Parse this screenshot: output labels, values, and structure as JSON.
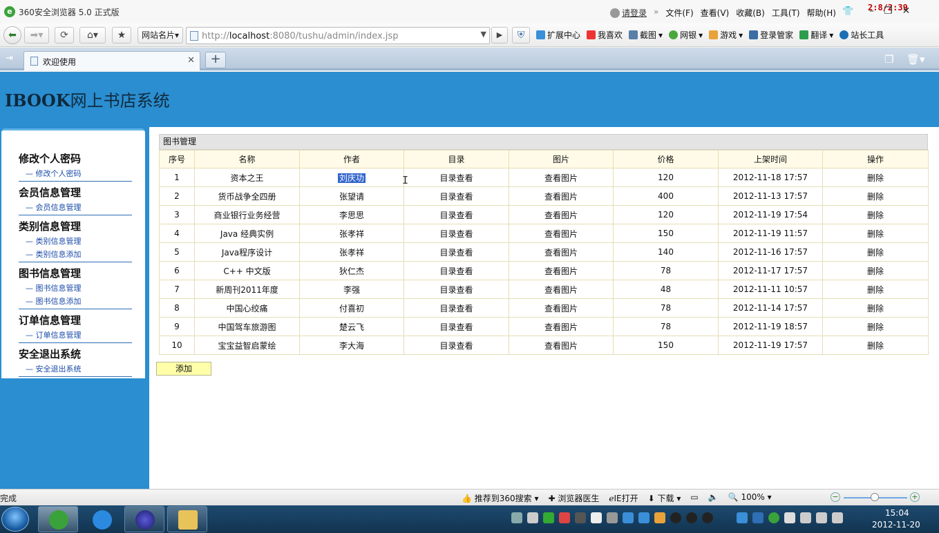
{
  "browser": {
    "title": "360安全浏览器 5.0 正式版",
    "menus": {
      "login": "请登录",
      "more": "»",
      "file": "文件(F)",
      "view": "查看(V)",
      "favorites": "收藏(B)",
      "tools": "工具(T)",
      "help": "帮助(H)"
    },
    "overlay_clock": "2:8/2:39",
    "address": {
      "card_label": "网站名片",
      "url_prefix": "http://",
      "url_host": "localhost",
      "url_rest": ":8080/tushu/admin/index.jsp"
    },
    "toolbar": [
      "扩展中心",
      "我喜欢",
      "截图",
      "网银",
      "游戏",
      "登录管家",
      "翻译",
      "站长工具"
    ],
    "tab": {
      "label": "欢迎使用"
    }
  },
  "site": {
    "brand": "IBOOK",
    "name": "网上书店系统"
  },
  "sidebar": [
    {
      "title": "修改个人密码",
      "links": [
        "修改个人密码"
      ]
    },
    {
      "title": "会员信息管理",
      "links": [
        "会员信息管理"
      ]
    },
    {
      "title": "类别信息管理",
      "links": [
        "类别信息管理",
        "类别信息添加"
      ]
    },
    {
      "title": "图书信息管理",
      "links": [
        "图书信息管理",
        "图书信息添加"
      ]
    },
    {
      "title": "订单信息管理",
      "links": [
        "订单信息管理"
      ]
    },
    {
      "title": "安全退出系统",
      "links": [
        "安全退出系统"
      ]
    }
  ],
  "books": {
    "caption": "图书管理",
    "columns": [
      "序号",
      "名称",
      "作者",
      "目录",
      "图片",
      "价格",
      "上架时间",
      "操作"
    ],
    "catalog_link": "目录查看",
    "image_link": "查看图片",
    "delete_link": "删除",
    "rows": [
      {
        "id": "1",
        "name": "资本之王",
        "author": "刘庆功",
        "price": "120",
        "date": "2012-11-18 17:57"
      },
      {
        "id": "2",
        "name": "货币战争全四册",
        "author": "张望请",
        "price": "400",
        "date": "2012-11-13 17:57"
      },
      {
        "id": "3",
        "name": "商业银行业务经营",
        "author": "李思思",
        "price": "120",
        "date": "2012-11-19 17:54"
      },
      {
        "id": "4",
        "name": "Java 经典实例",
        "author": "张孝祥",
        "price": "150",
        "date": "2012-11-19 11:57"
      },
      {
        "id": "5",
        "name": "Java程序设计",
        "author": "张孝祥",
        "price": "140",
        "date": "2012-11-16 17:57"
      },
      {
        "id": "6",
        "name": "C++ 中文版",
        "author": "狄仁杰",
        "price": "78",
        "date": "2012-11-17 17:57"
      },
      {
        "id": "7",
        "name": "新周刊2011年度",
        "author": "李强",
        "price": "48",
        "date": "2012-11-11 10:57"
      },
      {
        "id": "8",
        "name": "中国心绞痛",
        "author": "付喜初",
        "price": "78",
        "date": "2012-11-14 17:57"
      },
      {
        "id": "9",
        "name": "中国驾车旅游图",
        "author": "楚云飞",
        "price": "78",
        "date": "2012-11-19 18:57"
      },
      {
        "id": "10",
        "name": "宝宝益智启蒙绘",
        "author": "李大海",
        "price": "150",
        "date": "2012-11-19 17:57"
      }
    ],
    "add_label": "添加"
  },
  "statusbar": {
    "status": "完成",
    "recommend": "推荐到360搜索",
    "doctor": "浏览器医生",
    "ie_open": "IE打开",
    "download": "下载",
    "zoom": "100%"
  },
  "taskbar": {
    "time": "15:04",
    "date": "2012-11-20"
  }
}
